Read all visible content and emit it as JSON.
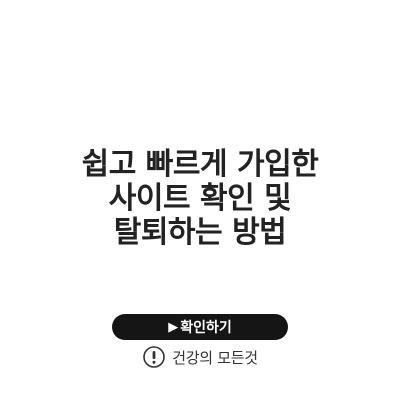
{
  "title": {
    "lines": [
      "쉽고 빠르게 가입한",
      "사이트 확인 및",
      "탈퇴하는 방법"
    ]
  },
  "confirm_button": {
    "arrow": "▶",
    "label": "확인하기"
  },
  "footer": {
    "icon": "exclamation-circle-icon",
    "text": "건강의 모든것"
  },
  "colors": {
    "background": "#ffffff",
    "title": "#222222",
    "button_bg": "#151515",
    "button_text": "#ffffff",
    "footer_text": "#333333"
  }
}
